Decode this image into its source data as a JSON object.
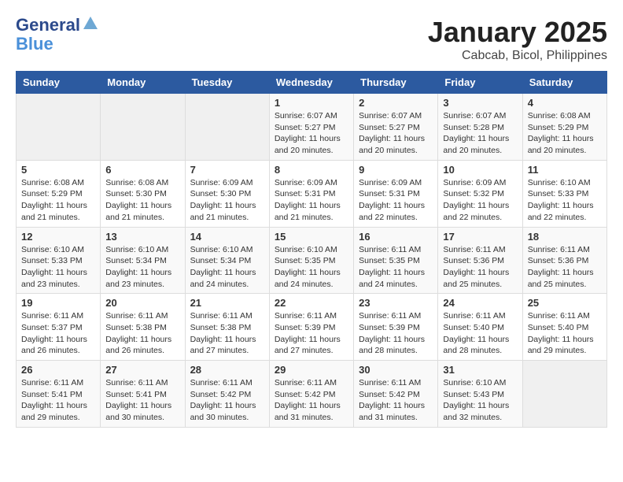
{
  "header": {
    "logo_line1": "General",
    "logo_line2": "Blue",
    "month_title": "January 2025",
    "subtitle": "Cabcab, Bicol, Philippines"
  },
  "weekdays": [
    "Sunday",
    "Monday",
    "Tuesday",
    "Wednesday",
    "Thursday",
    "Friday",
    "Saturday"
  ],
  "weeks": [
    [
      {
        "day": "",
        "info": ""
      },
      {
        "day": "",
        "info": ""
      },
      {
        "day": "",
        "info": ""
      },
      {
        "day": "1",
        "info": "Sunrise: 6:07 AM\nSunset: 5:27 PM\nDaylight: 11 hours\nand 20 minutes."
      },
      {
        "day": "2",
        "info": "Sunrise: 6:07 AM\nSunset: 5:27 PM\nDaylight: 11 hours\nand 20 minutes."
      },
      {
        "day": "3",
        "info": "Sunrise: 6:07 AM\nSunset: 5:28 PM\nDaylight: 11 hours\nand 20 minutes."
      },
      {
        "day": "4",
        "info": "Sunrise: 6:08 AM\nSunset: 5:29 PM\nDaylight: 11 hours\nand 20 minutes."
      }
    ],
    [
      {
        "day": "5",
        "info": "Sunrise: 6:08 AM\nSunset: 5:29 PM\nDaylight: 11 hours\nand 21 minutes."
      },
      {
        "day": "6",
        "info": "Sunrise: 6:08 AM\nSunset: 5:30 PM\nDaylight: 11 hours\nand 21 minutes."
      },
      {
        "day": "7",
        "info": "Sunrise: 6:09 AM\nSunset: 5:30 PM\nDaylight: 11 hours\nand 21 minutes."
      },
      {
        "day": "8",
        "info": "Sunrise: 6:09 AM\nSunset: 5:31 PM\nDaylight: 11 hours\nand 21 minutes."
      },
      {
        "day": "9",
        "info": "Sunrise: 6:09 AM\nSunset: 5:31 PM\nDaylight: 11 hours\nand 22 minutes."
      },
      {
        "day": "10",
        "info": "Sunrise: 6:09 AM\nSunset: 5:32 PM\nDaylight: 11 hours\nand 22 minutes."
      },
      {
        "day": "11",
        "info": "Sunrise: 6:10 AM\nSunset: 5:33 PM\nDaylight: 11 hours\nand 22 minutes."
      }
    ],
    [
      {
        "day": "12",
        "info": "Sunrise: 6:10 AM\nSunset: 5:33 PM\nDaylight: 11 hours\nand 23 minutes."
      },
      {
        "day": "13",
        "info": "Sunrise: 6:10 AM\nSunset: 5:34 PM\nDaylight: 11 hours\nand 23 minutes."
      },
      {
        "day": "14",
        "info": "Sunrise: 6:10 AM\nSunset: 5:34 PM\nDaylight: 11 hours\nand 24 minutes."
      },
      {
        "day": "15",
        "info": "Sunrise: 6:10 AM\nSunset: 5:35 PM\nDaylight: 11 hours\nand 24 minutes."
      },
      {
        "day": "16",
        "info": "Sunrise: 6:11 AM\nSunset: 5:35 PM\nDaylight: 11 hours\nand 24 minutes."
      },
      {
        "day": "17",
        "info": "Sunrise: 6:11 AM\nSunset: 5:36 PM\nDaylight: 11 hours\nand 25 minutes."
      },
      {
        "day": "18",
        "info": "Sunrise: 6:11 AM\nSunset: 5:36 PM\nDaylight: 11 hours\nand 25 minutes."
      }
    ],
    [
      {
        "day": "19",
        "info": "Sunrise: 6:11 AM\nSunset: 5:37 PM\nDaylight: 11 hours\nand 26 minutes."
      },
      {
        "day": "20",
        "info": "Sunrise: 6:11 AM\nSunset: 5:38 PM\nDaylight: 11 hours\nand 26 minutes."
      },
      {
        "day": "21",
        "info": "Sunrise: 6:11 AM\nSunset: 5:38 PM\nDaylight: 11 hours\nand 27 minutes."
      },
      {
        "day": "22",
        "info": "Sunrise: 6:11 AM\nSunset: 5:39 PM\nDaylight: 11 hours\nand 27 minutes."
      },
      {
        "day": "23",
        "info": "Sunrise: 6:11 AM\nSunset: 5:39 PM\nDaylight: 11 hours\nand 28 minutes."
      },
      {
        "day": "24",
        "info": "Sunrise: 6:11 AM\nSunset: 5:40 PM\nDaylight: 11 hours\nand 28 minutes."
      },
      {
        "day": "25",
        "info": "Sunrise: 6:11 AM\nSunset: 5:40 PM\nDaylight: 11 hours\nand 29 minutes."
      }
    ],
    [
      {
        "day": "26",
        "info": "Sunrise: 6:11 AM\nSunset: 5:41 PM\nDaylight: 11 hours\nand 29 minutes."
      },
      {
        "day": "27",
        "info": "Sunrise: 6:11 AM\nSunset: 5:41 PM\nDaylight: 11 hours\nand 30 minutes."
      },
      {
        "day": "28",
        "info": "Sunrise: 6:11 AM\nSunset: 5:42 PM\nDaylight: 11 hours\nand 30 minutes."
      },
      {
        "day": "29",
        "info": "Sunrise: 6:11 AM\nSunset: 5:42 PM\nDaylight: 11 hours\nand 31 minutes."
      },
      {
        "day": "30",
        "info": "Sunrise: 6:11 AM\nSunset: 5:42 PM\nDaylight: 11 hours\nand 31 minutes."
      },
      {
        "day": "31",
        "info": "Sunrise: 6:10 AM\nSunset: 5:43 PM\nDaylight: 11 hours\nand 32 minutes."
      },
      {
        "day": "",
        "info": ""
      }
    ]
  ]
}
